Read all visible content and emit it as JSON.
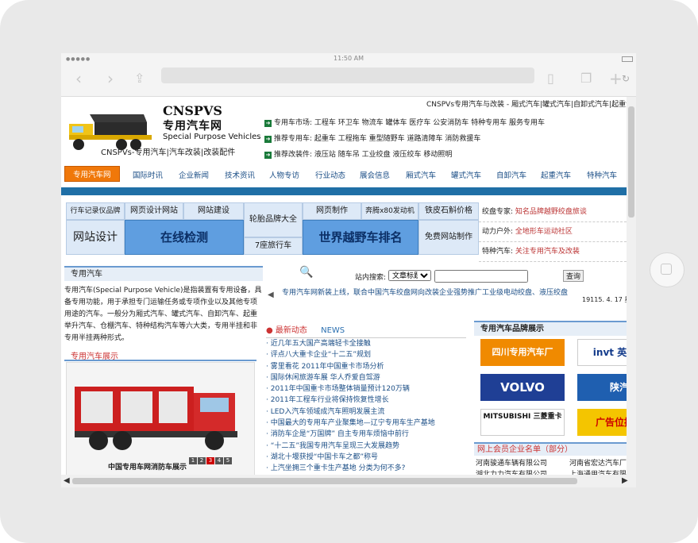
{
  "device": {
    "clock": "11:50 AM"
  },
  "site": {
    "logo_title": "CNSPVS",
    "logo_cn": "专用汽车网",
    "logo_en": "Special Purpose Vehicles",
    "logo_sub": "CNSPVs-专用汽车|汽车改装|改装配件",
    "top_links": "CNSPVs专用汽车与改装 - 厢式汽车|罐式汽车|自卸式汽车|起重汽车"
  },
  "quick_nav": [
    {
      "label": "专用车市场:",
      "items": "工程车  环卫车  物流车  罐体车  医疗车  公安消防车  特种专用车  服务专用车"
    },
    {
      "label": "推荐专用车:",
      "items": "起重车  工程拖车  重型随野车  道路清障车  消防救援车"
    },
    {
      "label": "推荐改装件:",
      "items": "液压站  随车吊  工业绞盘  液压绞车  移动照明"
    }
  ],
  "main_nav": [
    "专用汽车网",
    "国际时讯",
    "企业新闻",
    "技术资讯",
    "人物专访",
    "行业动态",
    "展会信息",
    "厢式汽车",
    "罐式汽车",
    "自卸汽车",
    "起重汽车",
    "特种汽车"
  ],
  "ads": {
    "cells": [
      "行车记录仪品牌",
      "网页设计网站",
      "网站建设",
      "轮胎品牌大全",
      "网页制作",
      "奔腾x80发动机",
      "铁皮石斛价格",
      "网站设计",
      "7座旅行车",
      "免费网站制作"
    ],
    "big1": "在线检测",
    "big2": "世界越野车排名"
  },
  "right_ads": [
    {
      "k": "绞盘专家:",
      "v": "知名品牌越野绞盘旅谈"
    },
    {
      "k": "动力户外:",
      "v": "全地形车运动社区"
    },
    {
      "k": "特种汽车:",
      "v": "关注专用汽车及改装"
    }
  ],
  "intro": {
    "heading": "专用汽车",
    "text": "专用汽车(Special Purpose Vehicle)是指装置有专用设备，具备专用功能，用于承担专门运输任务或专项作业以及其他专项用途的汽车。一般分为厢式汽车、罐式汽车、自卸汽车、起重举升汽车、仓棚汽车、特种结构汽车等六大类，专用半挂和非专用半挂两种形式。",
    "showcase_heading": "专用汽车展示",
    "photo_caption": "中国专用车网消防车展示",
    "pager": [
      "1",
      "2",
      "3",
      "4",
      "5"
    ]
  },
  "search": {
    "label": "站内搜索:",
    "option": "文章标题",
    "button": "查询"
  },
  "marquee": {
    "text": "专用汽车网新装上线，联合中国汽车绞盘网向改装企业强势推广工业级电动绞盘、液压绞盘",
    "date": "19115. 4. 17 星"
  },
  "news": {
    "title": "最新动态",
    "title_en": "NEWS",
    "items": [
      "近几年五大国产高端轻卡全接触",
      "评点八大重卡企业“十二五”规划",
      "雾里看花 2011年中国重卡市场分析",
      "国际休闲旅游车展 华人乔爱自驾游",
      "2011年中国重卡市场整体销量预计120万辆",
      "2011年工程车行业将保持恢复性增长",
      "LED入汽车领域成汽车照明发展主流",
      "中国最大的专用车产业聚集地—辽宁专用车生产基地",
      "消防车企是“万国牌” 自主专用车烦恼中前行",
      "“十二五”我国专用汽车呈现三大发展趋势",
      "湖北十堰获授“中国卡车之都”称号",
      "上汽坐拥三个重卡生产基地 分类为何不多?"
    ]
  },
  "brands": {
    "heading": "专用汽车品牌展示",
    "logos": [
      "四川专用汽车厂",
      "invt 英威腾",
      "VOLVO",
      "陕汽",
      "MITSUBISHI 三菱重卡",
      "广告位招租"
    ],
    "members_heading": "网上会员企业名单（部分）",
    "companies": [
      "河南骏通车辆有限公司",
      "河南省宏达汽车厂",
      "湖北力力汽车有限公司",
      "上海通用汽车有限"
    ]
  }
}
